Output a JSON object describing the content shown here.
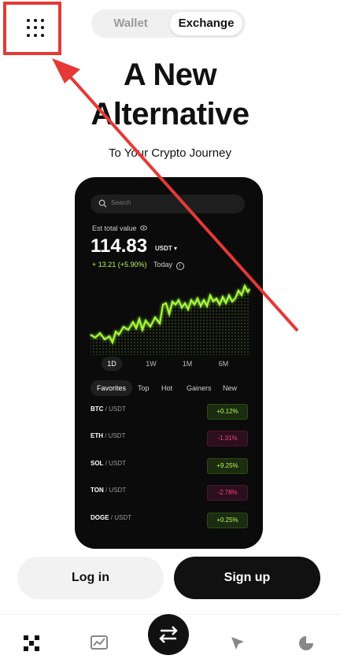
{
  "header": {
    "segments": [
      "Wallet",
      "Exchange"
    ],
    "headline": [
      "A New",
      "Alternative"
    ],
    "subtitle": "To Your Crypto Journey"
  },
  "phone": {
    "search_placeholder": "Search",
    "est_label": "Est total value",
    "balance": "114.83",
    "unit": "USDT",
    "change": "+ 13.21 (+5.90%)",
    "today": "Today",
    "timeframes": [
      "1D",
      "1W",
      "1M",
      "6M"
    ],
    "categories": [
      "Favorites",
      "Top",
      "Hot",
      "Gainers",
      "New"
    ],
    "quotes": "/ USDT",
    "rows": [
      {
        "symbol": "BTC",
        "change": "+0.12%",
        "positive": true
      },
      {
        "symbol": "ETH",
        "change": "-1.31%",
        "positive": false
      },
      {
        "symbol": "SOL",
        "change": "+9.25%",
        "positive": true
      },
      {
        "symbol": "TON",
        "change": "-2.78%",
        "positive": false
      },
      {
        "symbol": "DOGE",
        "change": "+0.25%",
        "positive": true
      }
    ]
  },
  "buttons": {
    "login": "Log in",
    "signup": "Sign up"
  },
  "colors": {
    "accent_green": "#b8f55a",
    "negative_pink": "#ff3d8a",
    "annotation_red": "#e53935"
  },
  "icons": [
    "grid-menu-icon",
    "search-icon",
    "eye-icon",
    "caret-down-icon",
    "info-icon",
    "okx-logo-icon",
    "markets-chart-icon",
    "trade-swap-icon",
    "explore-compass-icon",
    "portfolio-pie-icon"
  ]
}
